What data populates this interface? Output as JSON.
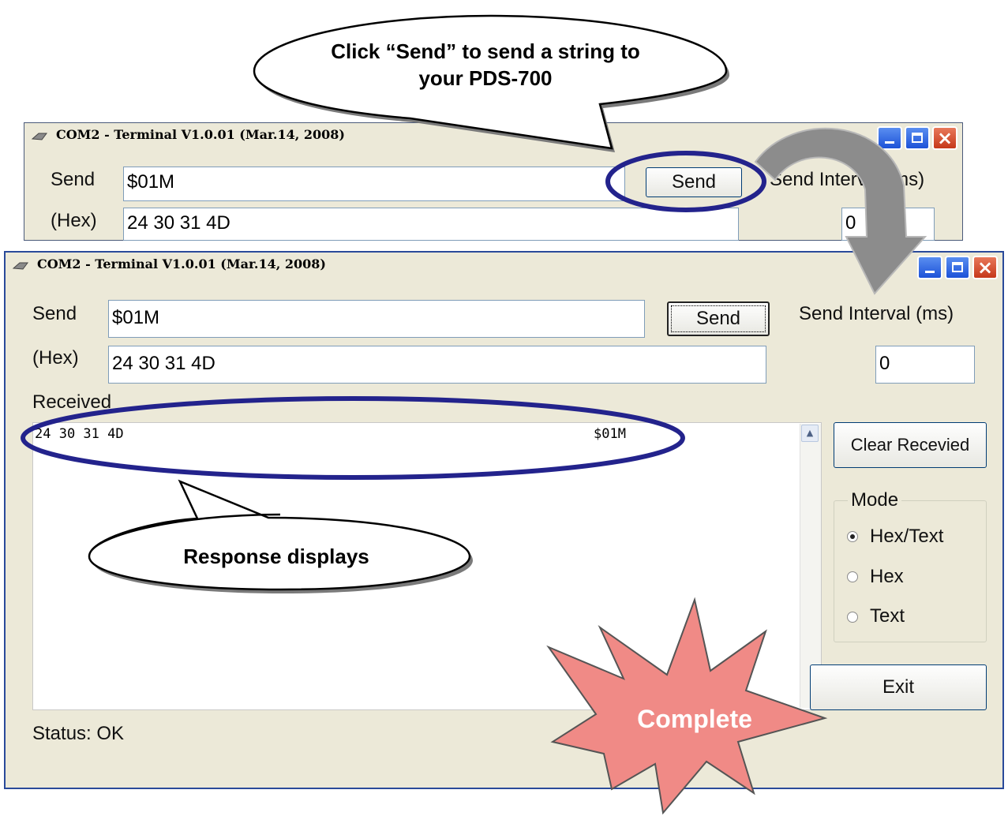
{
  "callouts": {
    "send_hint": "Click “Send” to send a string to your PDS-700",
    "response_hint": "Response displays",
    "complete": "Complete"
  },
  "back_window": {
    "title": "COM2 - Terminal V1.0.01 (Mar.14, 2008)",
    "send_label": "Send",
    "send_value": "$01M",
    "hex_label": "(Hex)",
    "hex_value": "24 30 31 4D",
    "send_button": "Send",
    "interval_label": "Send Interval (ms)",
    "interval_value": "0"
  },
  "front_window": {
    "title": "COM2 - Terminal V1.0.01 (Mar.14, 2008)",
    "send_label": "Send",
    "send_value": "$01M",
    "hex_label": "(Hex)",
    "hex_value": "24 30 31 4D",
    "send_button": "Send",
    "interval_label": "Send Interval (ms)",
    "interval_value": "0",
    "received_label": "Received",
    "received_hex": "24 30 31 4D",
    "received_text": "$01M",
    "clear_button": "Clear Recevied",
    "mode_label": "Mode",
    "mode_options": [
      {
        "label": "Hex/Text",
        "checked": true
      },
      {
        "label": "Hex",
        "checked": false
      },
      {
        "label": "Text",
        "checked": false
      }
    ],
    "exit_button": "Exit",
    "status": "Status: OK"
  },
  "colors": {
    "window_bg": "#ece9d8",
    "annotation_ring": "#2a2a9a",
    "burst_fill": "#f08080",
    "title_button_blue": "#1c52d8",
    "title_button_red": "#c6381a"
  },
  "icons": [
    "serial-port-icon",
    "minimize-icon",
    "maximize-icon",
    "close-icon",
    "scroll-up-arrow-icon"
  ]
}
